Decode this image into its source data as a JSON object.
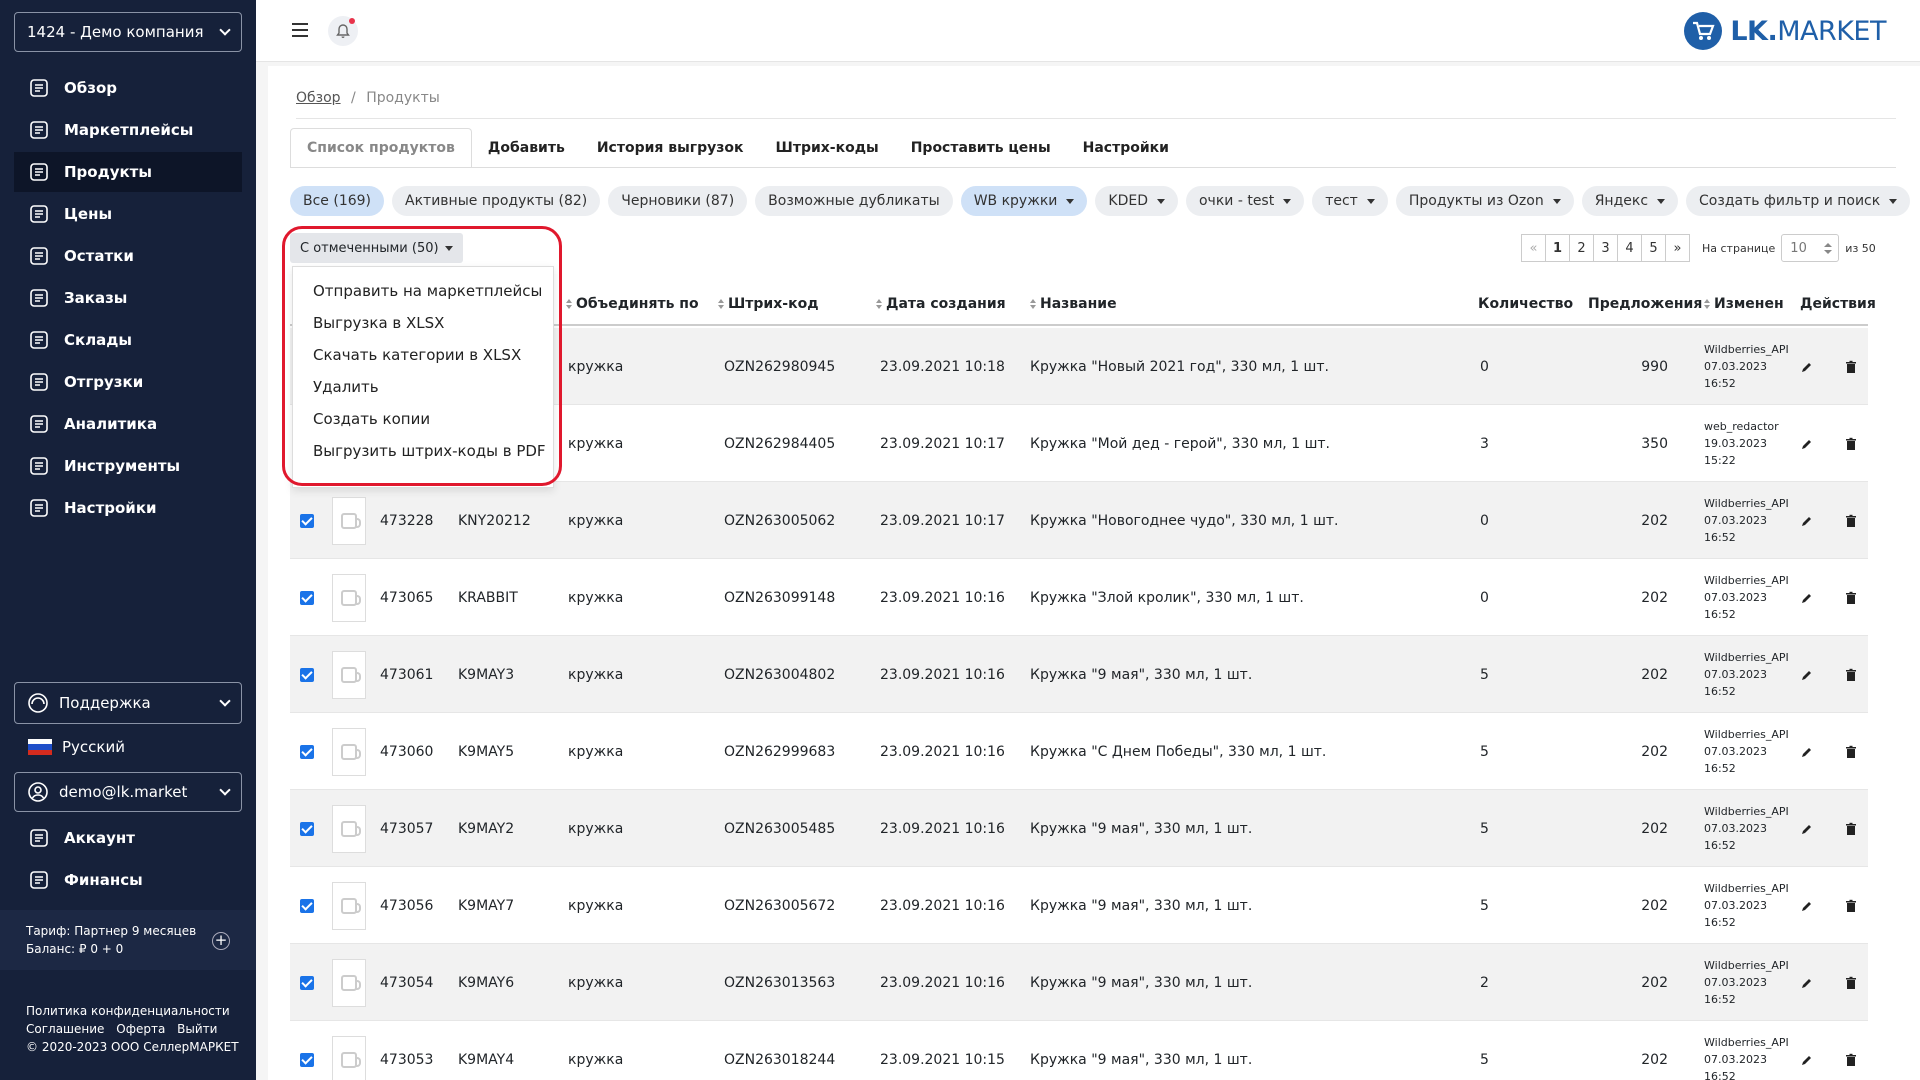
{
  "sidebar": {
    "company": "1424 - Демо компания",
    "nav": [
      {
        "label": "Обзор",
        "icon": "overview-icon"
      },
      {
        "label": "Маркетплейсы",
        "icon": "marketplaces-icon"
      },
      {
        "label": "Продукты",
        "icon": "products-icon",
        "active": true
      },
      {
        "label": "Цены",
        "icon": "prices-icon"
      },
      {
        "label": "Остатки",
        "icon": "stock-icon"
      },
      {
        "label": "Заказы",
        "icon": "orders-icon"
      },
      {
        "label": "Склады",
        "icon": "warehouses-icon"
      },
      {
        "label": "Отгрузки",
        "icon": "shipments-icon"
      },
      {
        "label": "Аналитика",
        "icon": "analytics-icon"
      },
      {
        "label": "Инструменты",
        "icon": "tools-icon"
      },
      {
        "label": "Настройки",
        "icon": "settings-icon"
      }
    ],
    "support": "Поддержка",
    "language": "Русский",
    "user": "demo@lk.market",
    "nav2": [
      {
        "label": "Аккаунт",
        "icon": "account-icon"
      },
      {
        "label": "Финансы",
        "icon": "finance-icon"
      }
    ],
    "tariff": "Тариф: Партнер 9 месяцев",
    "balance": "Баланс: ₽ 0 + 0",
    "footer": {
      "privacy": "Политика конфиденциальности",
      "agreement": "Соглашение",
      "offer": "Оферта",
      "logout": "Выйти",
      "copyright": "© 2020-2023 ООО СеллерМАРКЕТ"
    }
  },
  "header": {
    "logo_bold": "LK.",
    "logo_rest": "MARKET"
  },
  "breadcrumb": {
    "root": "Обзор",
    "sep": "/",
    "current": "Продукты"
  },
  "tabs": [
    "Список продуктов",
    "Добавить",
    "История выгрузок",
    "Штрих-коды",
    "Проставить цены",
    "Настройки"
  ],
  "filters": [
    {
      "label": "Все (169)",
      "active": true,
      "dropdown": false
    },
    {
      "label": "Активные продукты (82)",
      "dropdown": false
    },
    {
      "label": "Черновики (87)",
      "dropdown": false
    },
    {
      "label": "Возможные дубликаты",
      "dropdown": false
    },
    {
      "label": "WB кружки",
      "active": true,
      "dropdown": true
    },
    {
      "label": "KDED",
      "dropdown": true
    },
    {
      "label": "очки - test",
      "dropdown": true
    },
    {
      "label": "тест",
      "dropdown": true
    },
    {
      "label": "Продукты из Ozon",
      "dropdown": true
    },
    {
      "label": "Яндекс",
      "dropdown": true
    },
    {
      "label": "Создать фильтр и поиск",
      "dropdown": true
    }
  ],
  "bulk": {
    "label": "С отмеченными (50)",
    "menu": [
      "Отправить на маркетплейсы",
      "Выгрузка в XLSX",
      "Скачать категории в XLSX",
      "Удалить",
      "Создать копии",
      "Выгрузить штрих-коды в PDF"
    ]
  },
  "pagination": {
    "prev": "«",
    "pages": [
      "1",
      "2",
      "3",
      "4",
      "5"
    ],
    "next": "»",
    "per_page_label": "На странице",
    "per_page": "10",
    "of_label": "из 50"
  },
  "table": {
    "columns": {
      "group": "Объединять по",
      "barcode": "Штрих-код",
      "created": "Дата создания",
      "name": "Название",
      "qty": "Количество",
      "offers": "Предложения",
      "changed": "Изменен",
      "actions": "Действия"
    },
    "rows": [
      {
        "id": "",
        "sku": "",
        "group": "кружка",
        "barcode": "OZN262980945",
        "created": "23.09.2021 10:18",
        "name": "Кружка \"Новый 2021 год\", 330 мл, 1 шт.",
        "qty": "0",
        "offers": "990",
        "changed_by": "Wildberries_API",
        "changed_date": "07.03.2023",
        "changed_time": "16:52",
        "checked": false
      },
      {
        "id": "",
        "sku": "",
        "group": "кружка",
        "barcode": "OZN262984405",
        "created": "23.09.2021 10:17",
        "name": "Кружка \"Мой дед - герой\", 330 мл, 1 шт.",
        "qty": "3",
        "offers": "350",
        "changed_by": "web_redactor",
        "changed_date": "19.03.2023",
        "changed_time": "15:22",
        "checked": false
      },
      {
        "id": "473228",
        "sku": "KNY20212",
        "group": "кружка",
        "barcode": "OZN263005062",
        "created": "23.09.2021 10:17",
        "name": "Кружка \"Новогоднее чудо\", 330 мл, 1 шт.",
        "qty": "0",
        "offers": "202",
        "changed_by": "Wildberries_API",
        "changed_date": "07.03.2023",
        "changed_time": "16:52",
        "checked": true
      },
      {
        "id": "473065",
        "sku": "KRABBIT",
        "group": "кружка",
        "barcode": "OZN263099148",
        "created": "23.09.2021 10:16",
        "name": "Кружка \"Злой кролик\", 330 мл, 1 шт.",
        "qty": "0",
        "offers": "202",
        "changed_by": "Wildberries_API",
        "changed_date": "07.03.2023",
        "changed_time": "16:52",
        "checked": true
      },
      {
        "id": "473061",
        "sku": "K9MAY3",
        "group": "кружка",
        "barcode": "OZN263004802",
        "created": "23.09.2021 10:16",
        "name": "Кружка \"9 мая\", 330 мл, 1 шт.",
        "qty": "5",
        "offers": "202",
        "changed_by": "Wildberries_API",
        "changed_date": "07.03.2023",
        "changed_time": "16:52",
        "checked": true
      },
      {
        "id": "473060",
        "sku": "K9MAY5",
        "group": "кружка",
        "barcode": "OZN262999683",
        "created": "23.09.2021 10:16",
        "name": "Кружка \"С Днем Победы\", 330 мл, 1 шт.",
        "qty": "5",
        "offers": "202",
        "changed_by": "Wildberries_API",
        "changed_date": "07.03.2023",
        "changed_time": "16:52",
        "checked": true
      },
      {
        "id": "473057",
        "sku": "K9MAY2",
        "group": "кружка",
        "barcode": "OZN263005485",
        "created": "23.09.2021 10:16",
        "name": "Кружка \"9 мая\", 330 мл, 1 шт.",
        "qty": "5",
        "offers": "202",
        "changed_by": "Wildberries_API",
        "changed_date": "07.03.2023",
        "changed_time": "16:52",
        "checked": true
      },
      {
        "id": "473056",
        "sku": "K9MAY7",
        "group": "кружка",
        "barcode": "OZN263005672",
        "created": "23.09.2021 10:16",
        "name": "Кружка \"9 мая\", 330 мл, 1 шт.",
        "qty": "5",
        "offers": "202",
        "changed_by": "Wildberries_API",
        "changed_date": "07.03.2023",
        "changed_time": "16:52",
        "checked": true
      },
      {
        "id": "473054",
        "sku": "K9MAY6",
        "group": "кружка",
        "barcode": "OZN263013563",
        "created": "23.09.2021 10:16",
        "name": "Кружка \"9 мая\", 330 мл, 1 шт.",
        "qty": "2",
        "offers": "202",
        "changed_by": "Wildberries_API",
        "changed_date": "07.03.2023",
        "changed_time": "16:52",
        "checked": true
      },
      {
        "id": "473053",
        "sku": "K9MAY4",
        "group": "кружка",
        "barcode": "OZN263018244",
        "created": "23.09.2021 10:15",
        "name": "Кружка \"9 мая\", 330 мл, 1 шт.",
        "qty": "5",
        "offers": "202",
        "changed_by": "Wildberries_API",
        "changed_date": "07.03.2023",
        "changed_time": "16:52",
        "checked": true
      }
    ]
  },
  "colors": {
    "sidebar": "#16213a",
    "accent": "#1a73e8",
    "highlight": "#e0182d",
    "logo": "#1f5fa8"
  }
}
